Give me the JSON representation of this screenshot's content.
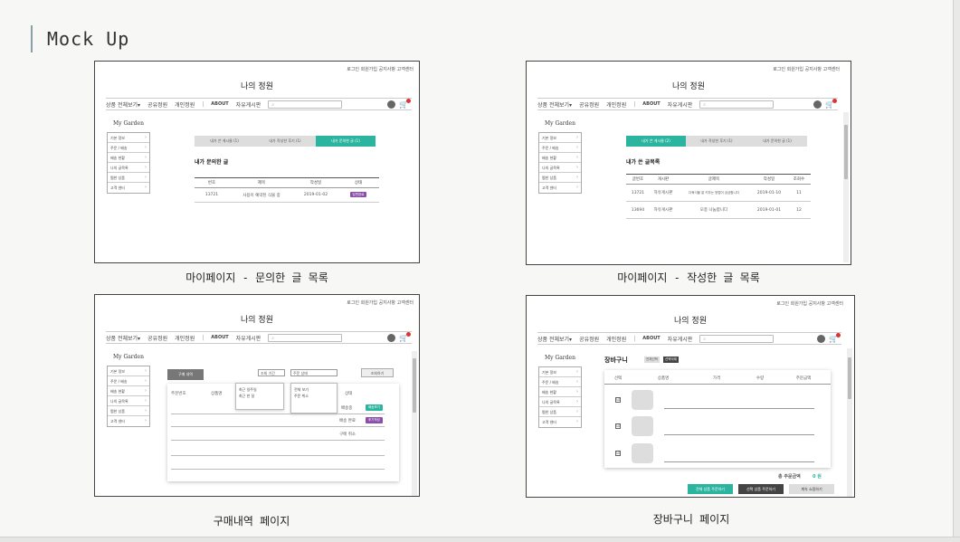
{
  "slide": {
    "title": "Mock Up"
  },
  "site": {
    "top_links": "로그인  회원가입  공지사항  고객센터",
    "logo": "나의 정원",
    "nav": [
      "상품 전체보기▾",
      "공유정원",
      "개인정원"
    ],
    "nav_sep": "|",
    "nav_about": "ABOUT",
    "nav_board": "자유게시판",
    "search_icon": "⌕",
    "cart_icon": "🛒",
    "sidebar_title": "My Garden",
    "sidebar_items": [
      "기본 정보",
      "주문 / 배송",
      "배송 현황",
      "나의 글목록",
      "찜한 상품",
      "고객 센터"
    ]
  },
  "shot1": {
    "caption": "마이페이지 - 문의한 글 목록",
    "tabs": [
      "내가 쓴 게시물 (1)",
      "내가 작성한 후기 (1)",
      "내가 문의한 글 (1)"
    ],
    "active_tab": 2,
    "section_title": "내가 문의한 글",
    "headers": [
      "번호",
      "제목",
      "작성일",
      "상태"
    ],
    "rows": [
      {
        "no": "13721",
        "title": "사용이 예약된 식물 중",
        "date": "2019-01-02",
        "status": "답변완료"
      }
    ]
  },
  "shot2": {
    "caption": "마이페이지 - 작성한 글 목록",
    "tabs": [
      "내가 쓴 게시물 (2)",
      "내가 작성한 후기 (1)",
      "내가 문의한 글 (1)"
    ],
    "active_tab": 0,
    "section_title": "내가 쓴 글목록",
    "headers": [
      "글번호",
      "게시판",
      "글제목",
      "작성일",
      "조회수"
    ],
    "rows": [
      {
        "no": "13721",
        "board": "자유게시판",
        "title": "다육식물 잘 키우는 방법이 궁금합니다",
        "date": "2019-01-10",
        "views": "11"
      },
      {
        "no": "13694",
        "board": "자유게시판",
        "title": "모종 나눔합니다",
        "date": "2019-01-01",
        "views": "12"
      }
    ]
  },
  "shot3": {
    "caption": "구매내역 페이지",
    "badge": "구매 내역",
    "period_select": "조회 기간",
    "status_select": "주문 상태",
    "search_button": "조회하기",
    "period_options": [
      "최근 일주일",
      "최근 한 달"
    ],
    "status_options": [
      "전체 보기",
      "주문 취소"
    ],
    "headers": [
      "주문번호",
      "상품명",
      "상태"
    ],
    "statuses": [
      "배송중",
      "배송 완료",
      "구매 취소"
    ],
    "status_buttons": [
      "배송보기",
      "후기작성"
    ]
  },
  "shot4": {
    "caption": "장바구니 페이지",
    "title": "장바구니",
    "mini_buttons": [
      "전체선택",
      "선택삭제"
    ],
    "headers": [
      "선택",
      "상품명",
      "가격",
      "수량",
      "주문금액"
    ],
    "check_icon": "☑",
    "total_label": "총 주문금액",
    "total_value": "0 원",
    "buttons": [
      "전체 상품 주문하기",
      "선택 상품 주문하기",
      "계속 쇼핑하기"
    ]
  },
  "colors": {
    "accent": "#2bb5a0",
    "purple": "#8a4fa8",
    "cart_badge": "#dd3333"
  }
}
